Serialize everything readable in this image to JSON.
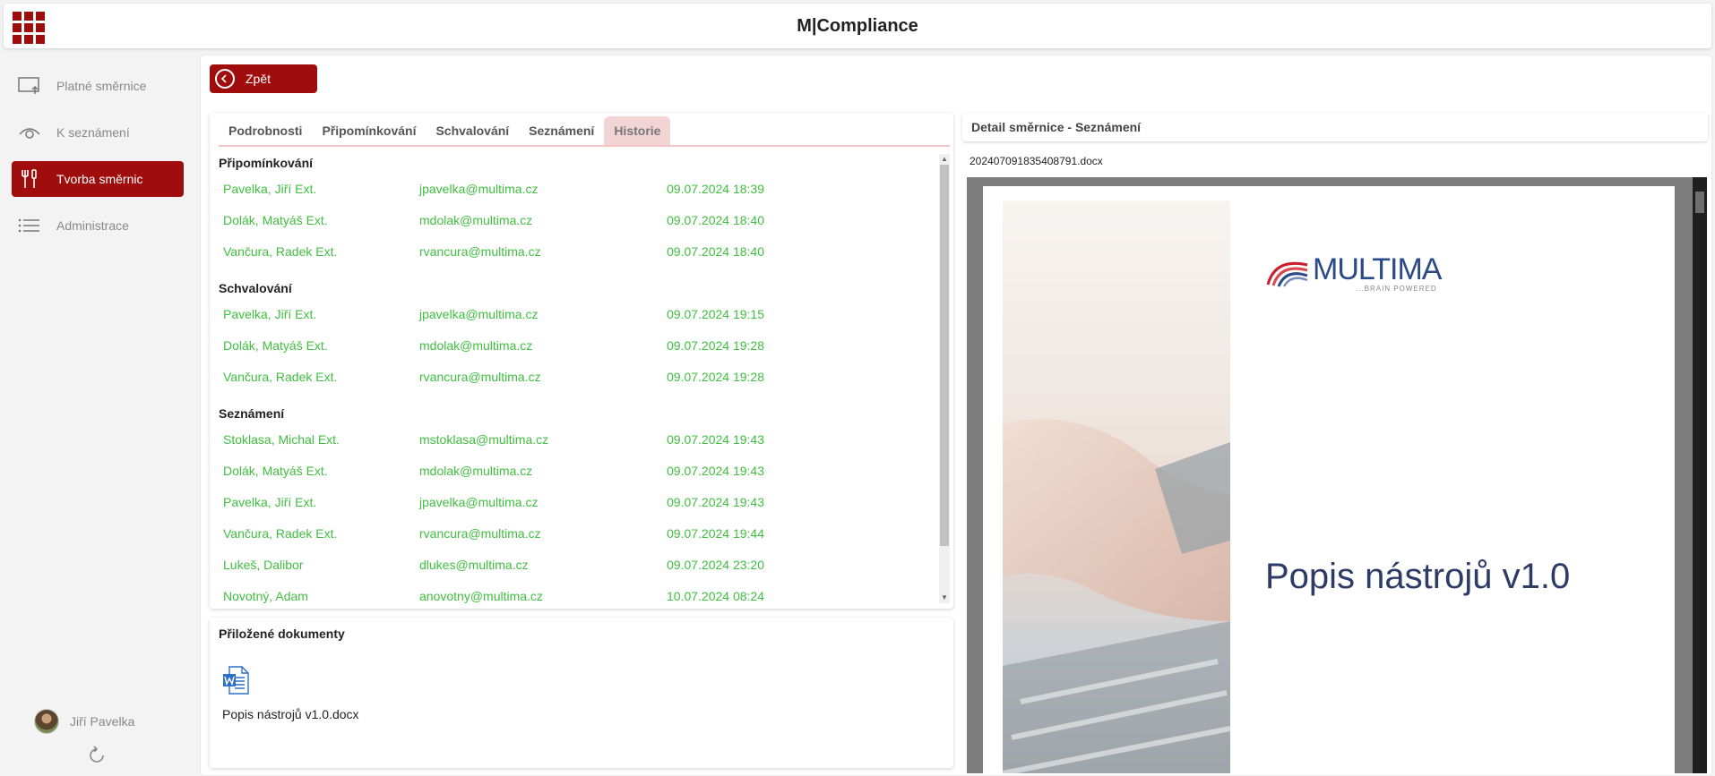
{
  "header": {
    "title": "M|Compliance",
    "menu_icon": "apps-grid-icon"
  },
  "sidebar": {
    "items": [
      {
        "label": "Platné směrnice",
        "icon": "monitor-upload-icon",
        "active": false
      },
      {
        "label": "K seznámení",
        "icon": "eye-icon",
        "active": false
      },
      {
        "label": "Tvorba směrnic",
        "icon": "tools-icon",
        "active": true
      },
      {
        "label": "Administrace",
        "icon": "list-icon",
        "active": false
      }
    ],
    "user_name": "Jiří Pavelka"
  },
  "toolbar": {
    "back_label": "Zpět"
  },
  "tabs": [
    "Podrobnosti",
    "Připomínkování",
    "Schvalování",
    "Seznámení",
    "Historie"
  ],
  "active_tab": "Historie",
  "history": {
    "sections": [
      {
        "title": "Připomínkování",
        "rows": [
          {
            "name": "Pavelka,  Jiří Ext.",
            "email": "jpavelka@multima.cz",
            "date": "09.07.2024 18:39"
          },
          {
            "name": "Dolák,  Matyáš Ext.",
            "email": "mdolak@multima.cz",
            "date": "09.07.2024 18:40"
          },
          {
            "name": "Vančura,  Radek Ext.",
            "email": "rvancura@multima.cz",
            "date": "09.07.2024 18:40"
          }
        ]
      },
      {
        "title": "Schvalování",
        "rows": [
          {
            "name": "Pavelka,  Jiří Ext.",
            "email": "jpavelka@multima.cz",
            "date": "09.07.2024 19:15"
          },
          {
            "name": "Dolák,  Matyáš Ext.",
            "email": "mdolak@multima.cz",
            "date": "09.07.2024 19:28"
          },
          {
            "name": "Vančura,  Radek Ext.",
            "email": "rvancura@multima.cz",
            "date": "09.07.2024 19:28"
          }
        ]
      },
      {
        "title": "Seznámení",
        "rows": [
          {
            "name": "Stoklasa,  Michal Ext.",
            "email": "mstoklasa@multima.cz",
            "date": "09.07.2024 19:43"
          },
          {
            "name": "Dolák,  Matyáš Ext.",
            "email": "mdolak@multima.cz",
            "date": "09.07.2024 19:43"
          },
          {
            "name": "Pavelka,  Jiří Ext.",
            "email": "jpavelka@multima.cz",
            "date": "09.07.2024 19:43"
          },
          {
            "name": "Vančura,  Radek Ext.",
            "email": "rvancura@multima.cz",
            "date": "09.07.2024 19:44"
          },
          {
            "name": "Lukeš,  Dalibor",
            "email": "dlukes@multima.cz",
            "date": "09.07.2024 23:20"
          },
          {
            "name": "Novotný,  Adam",
            "email": "anovotny@multima.cz",
            "date": "10.07.2024 08:24"
          }
        ]
      }
    ]
  },
  "attachments": {
    "title": "Přiložené dokumenty",
    "files": [
      {
        "name": "Popis nástrojů v1.0.docx",
        "icon": "word-document-icon"
      }
    ]
  },
  "detail": {
    "title": "Detail směrnice - Seznámení",
    "file_name": "202407091835408791.docx",
    "preview": {
      "logo_text": "MULTIMA",
      "logo_tagline": "...BRAIN POWERED",
      "doc_title": "Popis nástrojů v1.0"
    }
  },
  "colors": {
    "accent": "#a00d0d",
    "history_text": "#3fbf3f",
    "tab_active_bg": "#f2d4d4"
  }
}
